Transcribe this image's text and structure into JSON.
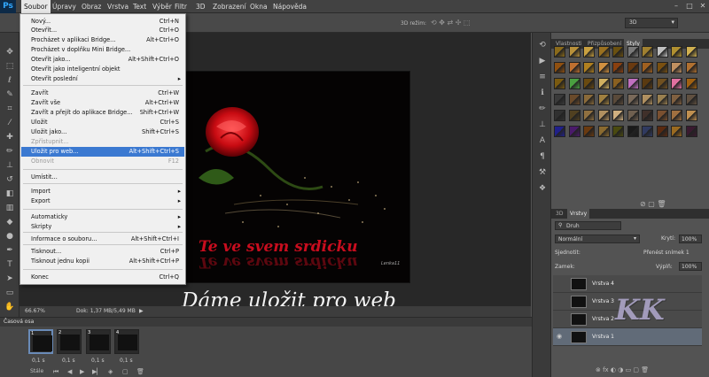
{
  "menubar": {
    "logo": "Ps",
    "items": [
      "Soubor",
      "Úpravy",
      "Obraz",
      "Vrstva",
      "Text",
      "Výběr",
      "Filtr",
      "3D",
      "Zobrazení",
      "Okna",
      "Nápověda"
    ],
    "active_index": 0
  },
  "options_bar": {
    "mode_label": "3D režim:",
    "workspace": "3D"
  },
  "file_menu": {
    "items": [
      {
        "label": "Nový...",
        "shortcut": "Ctrl+N"
      },
      {
        "label": "Otevřít...",
        "shortcut": "Ctrl+O"
      },
      {
        "label": "Procházet v aplikaci Bridge...",
        "shortcut": "Alt+Ctrl+O"
      },
      {
        "label": "Procházet v doplňku Mini Bridge...",
        "shortcut": ""
      },
      {
        "label": "Otevřít jako...",
        "shortcut": "Alt+Shift+Ctrl+O"
      },
      {
        "label": "Otevřít jako inteligentní objekt",
        "shortcut": ""
      },
      {
        "label": "Otevřít poslední",
        "shortcut": "",
        "submenu": true
      },
      {
        "label": "Zavřít",
        "shortcut": "Ctrl+W"
      },
      {
        "label": "Zavřít vše",
        "shortcut": "Alt+Ctrl+W"
      },
      {
        "label": "Zavřít a přejít do aplikace Bridge...",
        "shortcut": "Shift+Ctrl+W"
      },
      {
        "label": "Uložit",
        "shortcut": "Ctrl+S"
      },
      {
        "label": "Uložit jako...",
        "shortcut": "Shift+Ctrl+S"
      },
      {
        "label": "Zpřístupnit...",
        "shortcut": "",
        "disabled": true
      },
      {
        "label": "Uložit pro web...",
        "shortcut": "Alt+Shift+Ctrl+S",
        "highlighted": true
      },
      {
        "label": "Obnovit",
        "shortcut": "F12",
        "disabled": true
      },
      {
        "label": "Umístit...",
        "shortcut": ""
      },
      {
        "label": "Import",
        "shortcut": "",
        "submenu": true
      },
      {
        "label": "Export",
        "shortcut": "",
        "submenu": true
      },
      {
        "label": "Automaticky",
        "shortcut": "",
        "submenu": true
      },
      {
        "label": "Skripty",
        "shortcut": "",
        "submenu": true
      },
      {
        "label": "Informace o souboru...",
        "shortcut": "Alt+Shift+Ctrl+I"
      },
      {
        "label": "Tisknout...",
        "shortcut": "Ctrl+P"
      },
      {
        "label": "Tisknout jednu kopii",
        "shortcut": "Alt+Shift+Ctrl+P"
      },
      {
        "label": "Konec",
        "shortcut": "Ctrl+Q"
      }
    ]
  },
  "canvas": {
    "text": "Te ve svem srdicku",
    "text_reflection": "Te ve svem srdicku",
    "signature": "Lenka11"
  },
  "caption": "Dáme uložit pro web",
  "status_bar": {
    "zoom": "66.67%",
    "doc_info": "Dok: 1,37 MB/5,49 MB"
  },
  "timeline": {
    "title": "Časová osa",
    "frames": [
      {
        "number": "1",
        "duration": "0,1 s"
      },
      {
        "number": "2",
        "duration": "0,1 s"
      },
      {
        "number": "3",
        "duration": "0,1 s"
      },
      {
        "number": "4",
        "duration": "0,1 s"
      }
    ],
    "loop": "Stále"
  },
  "styles_panel": {
    "tabs": [
      "Vlastnosti",
      "Přizpůsobení",
      "Styly"
    ],
    "active_tab": 2,
    "swatch_colors": [
      "#8a6a1a",
      "#b8903a",
      "#c8a040",
      "#9a7020",
      "#6a5010",
      "#7a7a7a",
      "#a08030",
      "#c0c0c0",
      "#b09030",
      "#d0b050",
      "#905010",
      "#c07030",
      "#b08020",
      "#d09040",
      "#8a4010",
      "#6a3a10",
      "#a06020",
      "#7a5010",
      "#c09060",
      "#b07030",
      "#7a5a10",
      "#4aa040",
      "#6a4a10",
      "#d0b060",
      "#8a6020",
      "#c070c0",
      "#5a3a10",
      "#705020",
      "#e070a0",
      "#a06010",
      "#3a3a3a",
      "#6a4a2a",
      "#8a6a3a",
      "#a08040",
      "#5a4a3a",
      "#7a6a5a",
      "#b09060",
      "#9a8050",
      "#806040",
      "#605040",
      "#303030",
      "#504020",
      "#907040",
      "#b09060",
      "#d0b080",
      "#706050",
      "#40302a",
      "#7a5030",
      "#a07040",
      "#c09050",
      "#20208a",
      "#4a1a6a",
      "#6a3a10",
      "#8a6a30",
      "#4a4a10",
      "#1a1a1a",
      "#303a60",
      "#5a2a10",
      "#9a6a20",
      "#3a1a30"
    ]
  },
  "layers_panel": {
    "tabs": [
      "3D",
      "Vrstvy"
    ],
    "active_tab": 1,
    "filter": "Druh",
    "blend_mode": "Normální",
    "opacity_label": "Krytí:",
    "opacity": "100%",
    "unify_label": "Sjednotit:",
    "propagate_label": "Přenést snímek 1",
    "lock_label": "Zamek:",
    "fill_label": "Výplň:",
    "fill": "100%",
    "layers": [
      {
        "name": "Vrstva 4",
        "visible": false
      },
      {
        "name": "Vrstva 3",
        "visible": false
      },
      {
        "name": "Vrstva 2",
        "visible": false
      },
      {
        "name": "Vrstva 1",
        "visible": true,
        "selected": true
      }
    ]
  },
  "watermark": "KK"
}
